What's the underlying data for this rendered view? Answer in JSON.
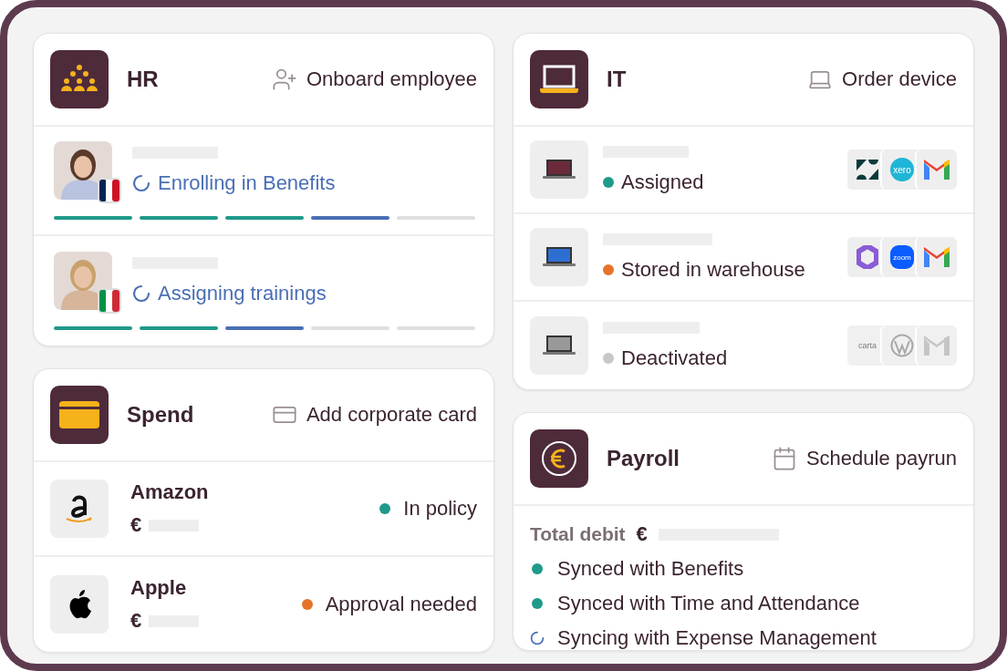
{
  "left": [
    {
      "kind": "hr",
      "title": "HR",
      "action": "Onboard employee",
      "employees": [
        {
          "flag": [
            {
              "color": "#002654"
            },
            {
              "color": "#ffffff"
            },
            {
              "color": "#ce1126"
            }
          ],
          "status": "Enrolling in Benefits",
          "steps": [
            {
              "kind": "done"
            },
            {
              "kind": "done"
            },
            {
              "kind": "done"
            },
            {
              "kind": "current"
            },
            {
              "kind": "todo"
            }
          ]
        },
        {
          "flag": [
            {
              "color": "#009246"
            },
            {
              "color": "#ffffff"
            },
            {
              "color": "#ce2b37"
            }
          ],
          "status": "Assigning trainings",
          "steps": [
            {
              "kind": "done"
            },
            {
              "kind": "done"
            },
            {
              "kind": "current"
            },
            {
              "kind": "todo"
            },
            {
              "kind": "todo"
            }
          ]
        }
      ]
    },
    {
      "kind": "spend",
      "title": "Spend",
      "action": "Add corporate card",
      "merchants": [
        {
          "kind": "amazon",
          "name": "Amazon",
          "currency": "€",
          "status": "In policy",
          "color": "#1f9a8a"
        },
        {
          "kind": "apple",
          "name": "Apple",
          "currency": "€",
          "status": "Approval needed",
          "color": "#e5742a"
        }
      ]
    }
  ],
  "right": [
    {
      "kind": "it",
      "title": "IT",
      "action": "Order device",
      "devices": [
        {
          "status": "Assigned",
          "color": "#1f9a8a",
          "dimmed": false,
          "apps": [
            {
              "kind": "zendesk"
            },
            {
              "kind": "xero",
              "label": "xero"
            },
            {
              "kind": "gmail"
            }
          ]
        },
        {
          "status": "Stored in warehouse",
          "color": "#e5742a",
          "dimmed": false,
          "apps": [
            {
              "kind": "office"
            },
            {
              "kind": "zoom",
              "label": "zoom"
            },
            {
              "kind": "gmail"
            }
          ]
        },
        {
          "status": "Deactivated",
          "color": "#c9c7c8",
          "dimmed": true,
          "apps": [
            {
              "kind": "carta",
              "label": "carta"
            },
            {
              "kind": "wordpress"
            },
            {
              "kind": "gmail"
            }
          ]
        }
      ]
    },
    {
      "kind": "payroll",
      "title": "Payroll",
      "action": "Schedule payrun",
      "total_label": "Total debit",
      "currency": "€",
      "syncs": [
        {
          "kind": "done",
          "color": "#1f9a8a",
          "text": "Synced with Benefits"
        },
        {
          "kind": "done",
          "color": "#1f9a8a",
          "text": "Synced with Time and Attendance"
        },
        {
          "kind": "syncing",
          "text": "Syncing with Expense Management"
        }
      ]
    }
  ]
}
